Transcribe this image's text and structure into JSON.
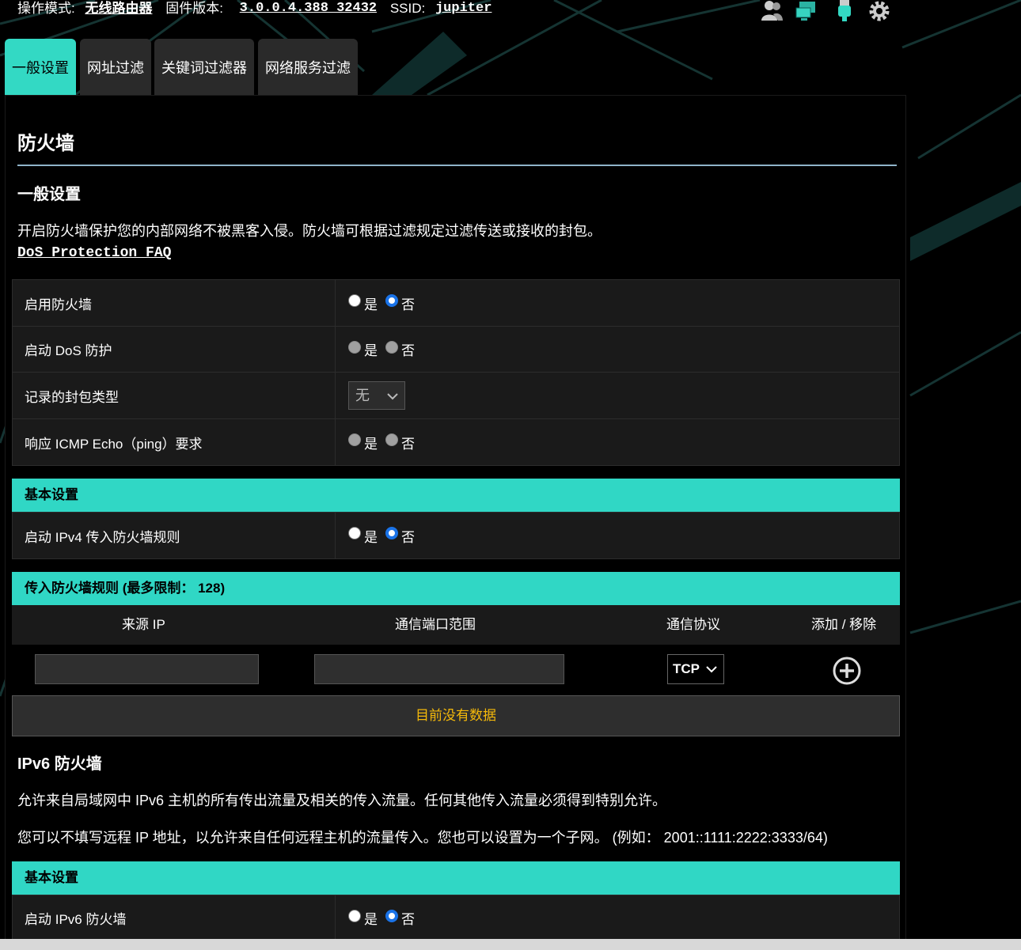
{
  "topbar": {
    "mode_label": "操作模式:",
    "mode_value": "无线路由器",
    "firmware_label": "固件版本:",
    "firmware_value": "3.0.0.4.388_32432",
    "ssid_label": "SSID:",
    "ssid_value": "jupiter",
    "icons": [
      "users-icon",
      "network-map-icon",
      "usb-icon",
      "settings-icon"
    ]
  },
  "tabs": [
    {
      "label": "一般设置",
      "active": true
    },
    {
      "label": "网址过滤",
      "active": false
    },
    {
      "label": "关键词过滤器",
      "active": false
    },
    {
      "label": "网络服务过滤",
      "active": false
    }
  ],
  "page": {
    "title": "防火墙",
    "subtitle": "一般设置",
    "description": "开启防火墙保护您的内部网络不被黑客入侵。防火墙可根据过滤规定过滤传送或接收的封包。",
    "faq_link": "DoS Protection FAQ"
  },
  "general": {
    "enable_firewall": {
      "label": "启用防火墙",
      "yes": "是",
      "no": "否",
      "selected": "no"
    },
    "enable_dos": {
      "label": "启动 DoS 防护",
      "yes": "是",
      "no": "否",
      "selected": "none",
      "disabled": true
    },
    "logged_packets": {
      "label": "记录的封包类型",
      "value": "无"
    },
    "respond_icmp": {
      "label": "响应 ICMP Echo（ping）要求",
      "yes": "是",
      "no": "否",
      "selected": "none",
      "disabled": true
    }
  },
  "basic_ipv4": {
    "header": "基本设置",
    "enable_ipv4_inbound": {
      "label": "启动 IPv4 传入防火墙规则",
      "yes": "是",
      "no": "否",
      "selected": "no"
    }
  },
  "inbound_rules": {
    "header": "传入防火墙规则 (最多限制： 128)",
    "columns": [
      "来源 IP",
      "通信端口范围",
      "通信协议",
      "添加 / 移除"
    ],
    "source_ip_value": "",
    "port_range_value": "",
    "protocol_value": "TCP",
    "empty_text": "目前没有数据"
  },
  "ipv6": {
    "title": "IPv6 防火墙",
    "desc1": "允许来自局域网中 IPv6 主机的所有传出流量及相关的传入流量。任何其他传入流量必须得到特别允许。",
    "desc2": "您可以不填写远程 IP 地址，以允许来自任何远程主机的流量传入。您也可以设置为一个子网。 (例如： 2001::1111:2222:3333/64)",
    "basic_header": "基本设置",
    "enable_ipv6_firewall": {
      "label": "启动 IPv6 防火墙",
      "yes": "是",
      "no": "否",
      "selected": "no"
    }
  },
  "colors": {
    "accent": "#30d7c5",
    "nodata": "#f5b90a",
    "radio_selected": "#1a73e8"
  }
}
